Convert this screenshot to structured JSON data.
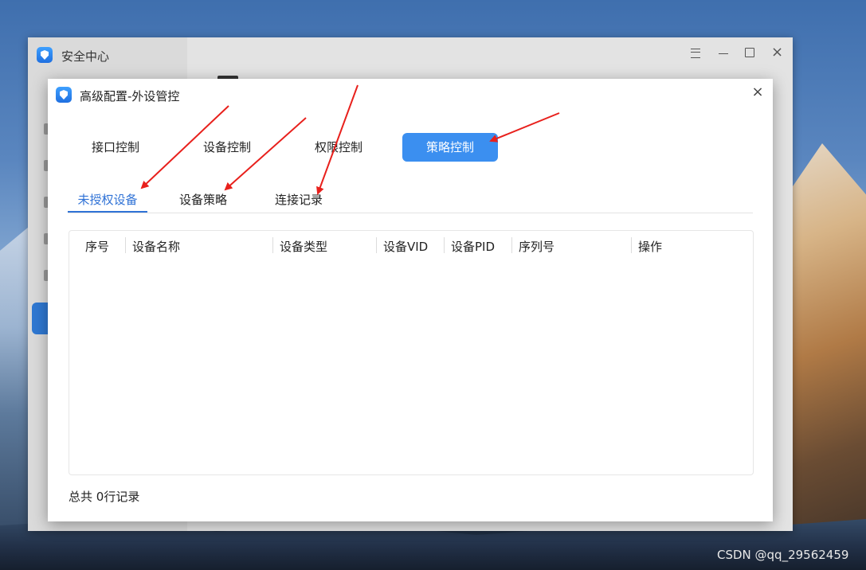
{
  "background_window": {
    "title": "安全中心",
    "controls": [
      "menu-icon",
      "minimize-icon",
      "maximize-icon",
      "close-icon"
    ]
  },
  "dialog": {
    "title": "高级配置-外设管控",
    "top_tabs": [
      {
        "label": "接口控制",
        "active": false
      },
      {
        "label": "设备控制",
        "active": false
      },
      {
        "label": "权限控制",
        "active": false
      },
      {
        "label": "策略控制",
        "active": true
      }
    ],
    "sub_tabs": [
      {
        "label": "未授权设备",
        "active": true
      },
      {
        "label": "设备策略",
        "active": false
      },
      {
        "label": "连接记录",
        "active": false
      }
    ],
    "table": {
      "columns": [
        "序号",
        "设备名称",
        "设备类型",
        "设备VID",
        "设备PID",
        "序列号",
        "操作"
      ],
      "rows": []
    },
    "footer": {
      "prefix": "总共",
      "count": "0",
      "suffix": "行记录"
    }
  },
  "watermark": "CSDN @qq_29562459",
  "colors": {
    "accent": "#3b8ff0",
    "active_subtab": "#2f72d6",
    "annotation_arrow": "#e8201c"
  }
}
